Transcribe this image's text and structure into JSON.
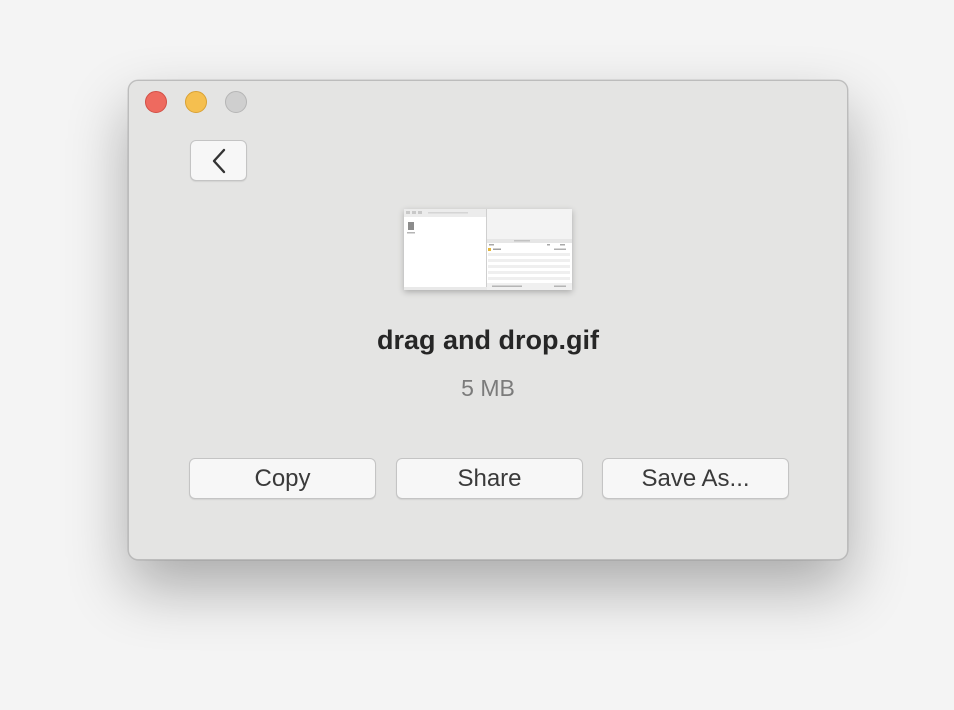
{
  "window": {
    "controls": {
      "close_icon": "close-icon",
      "minimize_icon": "minimize-icon",
      "zoom_icon": "zoom-icon",
      "close_color": "#ee6a5f",
      "minimize_color": "#f5bf4f",
      "zoom_color": "#cfcfcf"
    }
  },
  "toolbar": {
    "back_icon": "chevron-left-icon"
  },
  "file": {
    "thumbnail_icon": "file-preview-thumbnail",
    "name": "drag and drop.gif",
    "size": "5 MB"
  },
  "actions": {
    "copy_label": "Copy",
    "share_label": "Share",
    "save_as_label": "Save As..."
  }
}
